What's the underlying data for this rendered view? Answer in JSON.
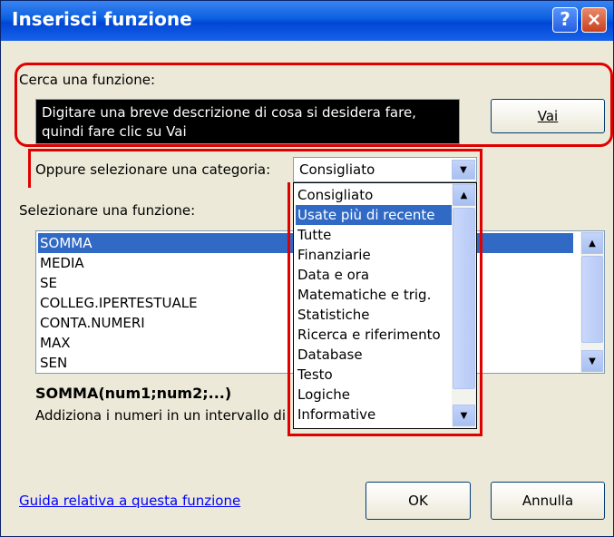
{
  "window": {
    "title": "Inserisci funzione",
    "help_glyph": "?",
    "close_glyph": "×"
  },
  "search": {
    "label": "Cerca una funzione:",
    "text_line1": "Digitare una breve descrizione di cosa si desidera fare,",
    "text_line2": "quindi fare clic su Vai",
    "go_button": "Vai"
  },
  "category": {
    "label": "Oppure selezionare una categoria:",
    "selected": "Consigliato"
  },
  "dropdown_options": [
    "Consigliato",
    "Usate più di recente",
    "Tutte",
    "Finanziarie",
    "Data e ora",
    "Matematiche e trig.",
    "Statistiche",
    "Ricerca e riferimento",
    "Database",
    "Testo",
    "Logiche",
    "Informative"
  ],
  "dropdown_highlighted_index": 1,
  "functions": {
    "label": "Selezionare una funzione:",
    "items": [
      "SOMMA",
      "MEDIA",
      "SE",
      "COLLEG.IPERTESTUALE",
      "CONTA.NUMERI",
      "MAX",
      "SEN"
    ],
    "selected_index": 0
  },
  "syntax": "SOMMA(num1;num2;...)",
  "description": "Addiziona i numeri in un intervallo di",
  "footer": {
    "help_link": "Guida relativa a questa funzione",
    "ok": "OK",
    "cancel": "Annulla"
  },
  "colors": {
    "highlight_box": "#e00000",
    "selection": "#316ac5",
    "dialog_bg": "#ece9d8"
  }
}
